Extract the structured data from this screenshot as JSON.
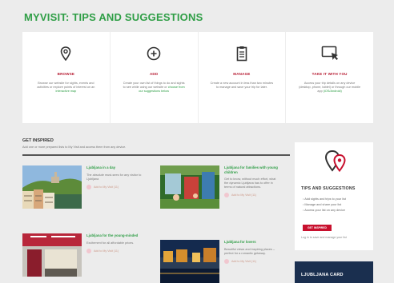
{
  "header": {
    "title": "MYVISIT: TIPS AND SUGGESTIONS"
  },
  "steps": [
    {
      "icon": "map-pin-icon",
      "label": "BROWSE",
      "desc": "Browse our website for sights, events and activities or explore points of interest on an",
      "link": "interactive map"
    },
    {
      "icon": "add-circle-icon",
      "label": "ADD",
      "desc": "Create your own list of things to do and sights to see while using our website or",
      "link": "choose from our suggestions below"
    },
    {
      "icon": "clipboard-icon",
      "label": "MANAGE",
      "desc": "Create a new account in less than two minutes to manage and save your trip for later.",
      "link": ""
    },
    {
      "icon": "tablet-touch-icon",
      "label": "TAKE IT WITH YOU",
      "desc": "Access your trip details on any device (desktop, phone, tablet) or through our mobile app",
      "link": "(iOS/Android)"
    }
  ],
  "inspired": {
    "title": "GET INSPIRED",
    "subtitle": "Add one or more prepared lists to My Visit and access them from any device."
  },
  "cards": [
    {
      "title": "Ljubljana in a day",
      "desc": "The absolute must-sees for any visitor to Ljubljana",
      "add": "Add to My Visit (11)"
    },
    {
      "title": "Ljubljana for families with young children",
      "desc": "Get to know, without much effort, what the dynamic Ljubljana has to offer in terms of natural attractions.",
      "add": "Add to My Visit (11)"
    },
    {
      "title": "Ljubljana for the young-minded",
      "desc": "Excitement for all affordable prices.",
      "add": "Add to My Visit (11)"
    },
    {
      "title": "Ljubljana for lovers",
      "desc": "Beautiful views and inspiring places – perfect for a romantic getaway.",
      "add": "Add to My Visit (11)"
    }
  ],
  "side": {
    "title": "TIPS AND SUGGESTIONS",
    "items": [
      "Add sights and trips to your list",
      "Manage and share your list",
      "Access your list on any device"
    ],
    "button": "GET INSPIRED",
    "login_pre": "Log in to save and manage your list",
    "login_link": ""
  },
  "ljcard": {
    "title": "LJUBLJANA CARD"
  },
  "colors": {
    "green": "#2f9e46",
    "red": "#c8102e",
    "navy": "#1a2f4f"
  }
}
